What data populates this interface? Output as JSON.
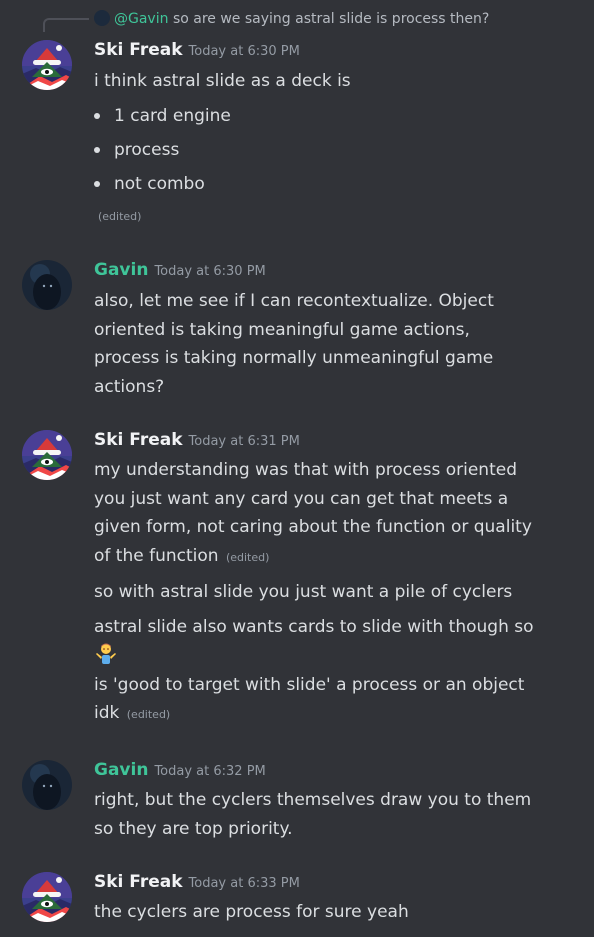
{
  "reply": {
    "mention": "@Gavin",
    "text": "so are we saying astral slide is process then?"
  },
  "messages": [
    {
      "author": "Ski Freak",
      "timestamp": "Today at 6:30 PM",
      "lines": [
        "i think astral slide as a deck is"
      ],
      "bullets": [
        "1 card engine",
        "process",
        "not combo"
      ],
      "edited": "(edited)"
    },
    {
      "author": "Gavin",
      "timestamp": "Today at 6:30 PM",
      "lines": [
        "also, let me see if I can recontextualize. Object",
        "oriented is taking meaningful game actions,",
        "process is taking normally unmeaningful game",
        "actions?"
      ]
    },
    {
      "author": "Ski Freak",
      "timestamp": "Today at 6:31 PM",
      "lines": [
        "my understanding was that with process oriented",
        "you just want any card you can get that meets a",
        "given form, not caring about the function or quality",
        "of the function",
        "so with astral slide you just want a pile of cyclers",
        "astral slide also wants cards to slide with though so",
        "is 'good to target with slide' a process or an object",
        "idk"
      ],
      "edited": "(edited)",
      "emoji": "person-shrugging-emoji"
    },
    {
      "author": "Gavin",
      "timestamp": "Today at 6:32 PM",
      "lines": [
        "right, but the cyclers themselves draw you to them",
        "so they are top priority."
      ]
    },
    {
      "author": "Ski Freak",
      "timestamp": "Today at 6:33 PM",
      "lines": [
        "the cyclers are process for sure yeah"
      ]
    }
  ],
  "colors": {
    "background": "#313338",
    "gavin_name": "#3fc599",
    "text": "#dbdee1",
    "muted": "#949ba4"
  }
}
